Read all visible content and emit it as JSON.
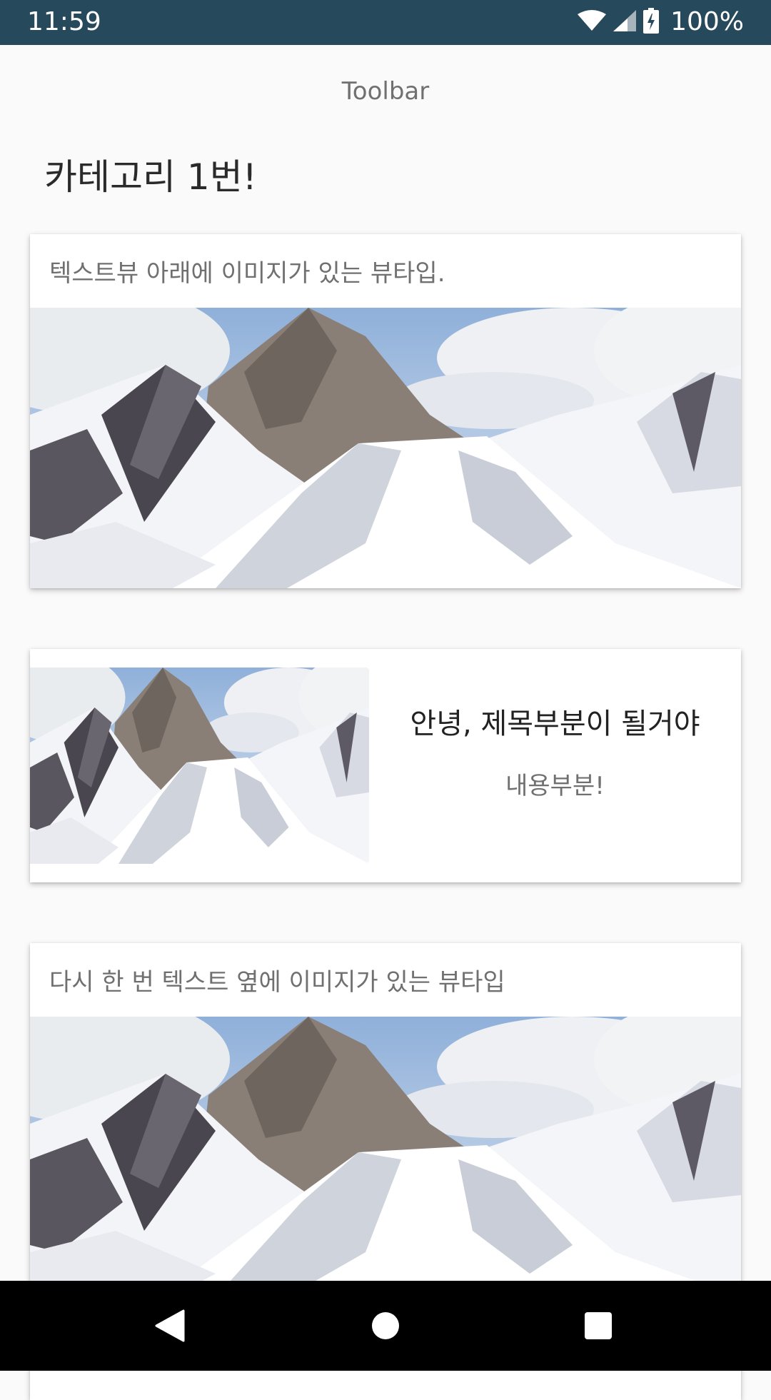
{
  "status_bar": {
    "time": "11:59",
    "battery": "100%",
    "background": "#27495c",
    "icons": [
      "wifi-icon",
      "signal-icon",
      "battery-charging-icon"
    ]
  },
  "toolbar": {
    "title": "Toolbar"
  },
  "category": {
    "title": "카테고리 1번!"
  },
  "cards": [
    {
      "caption": "텍스트뷰 아래에 이미지가 있는 뷰타입.",
      "image": "snowy-mountain-image"
    },
    {
      "title": "안녕, 제목부분이 될거야",
      "subtitle": "내용부분!",
      "image": "snowy-mountain-image"
    },
    {
      "caption": "다시 한 번 텍스트 옆에 이미지가 있는 뷰타입",
      "image": "snowy-mountain-image"
    }
  ],
  "nav_bar": {
    "icons": [
      "back-icon",
      "home-icon",
      "recents-icon"
    ]
  }
}
